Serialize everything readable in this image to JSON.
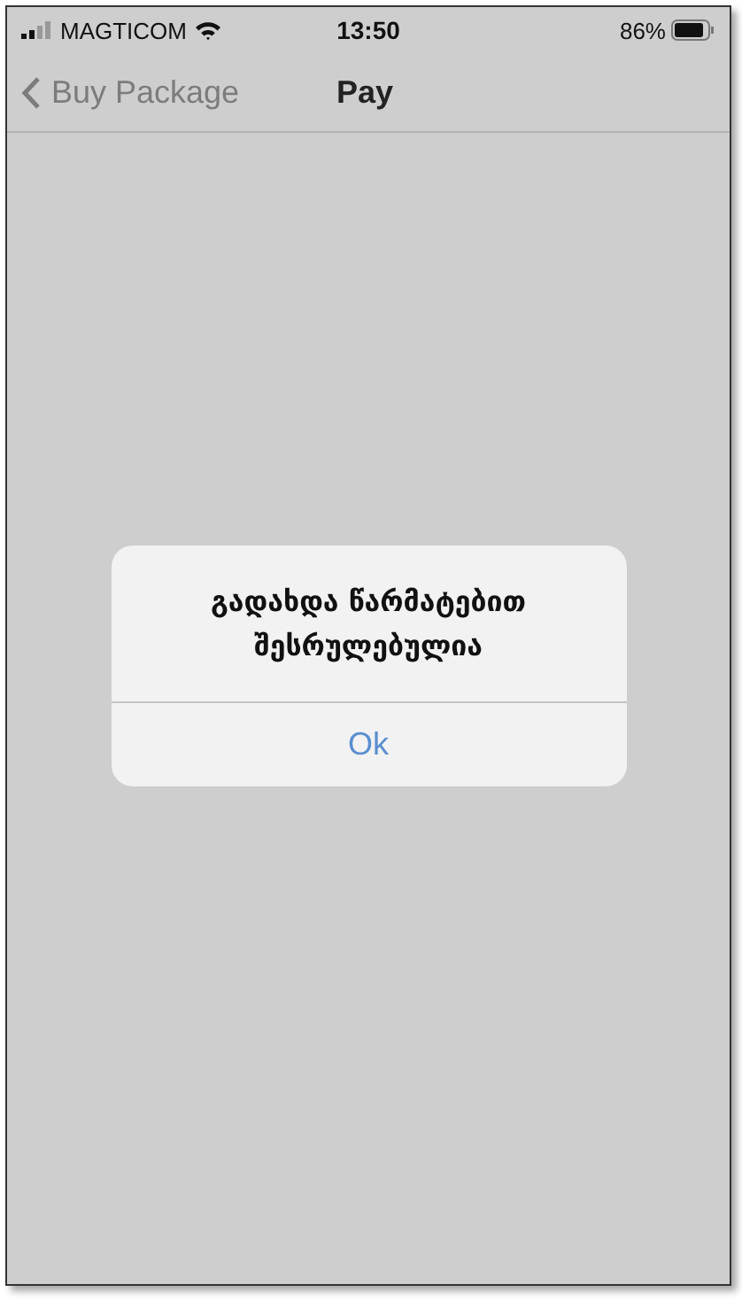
{
  "status_bar": {
    "carrier": "MAGTICOM",
    "time": "13:50",
    "battery": "86%"
  },
  "nav_bar": {
    "back_label": "Buy Package",
    "title": "Pay"
  },
  "alert": {
    "message": "გადახდა წარმატებით შესრულებულია",
    "buttons": [
      "Ok"
    ]
  }
}
